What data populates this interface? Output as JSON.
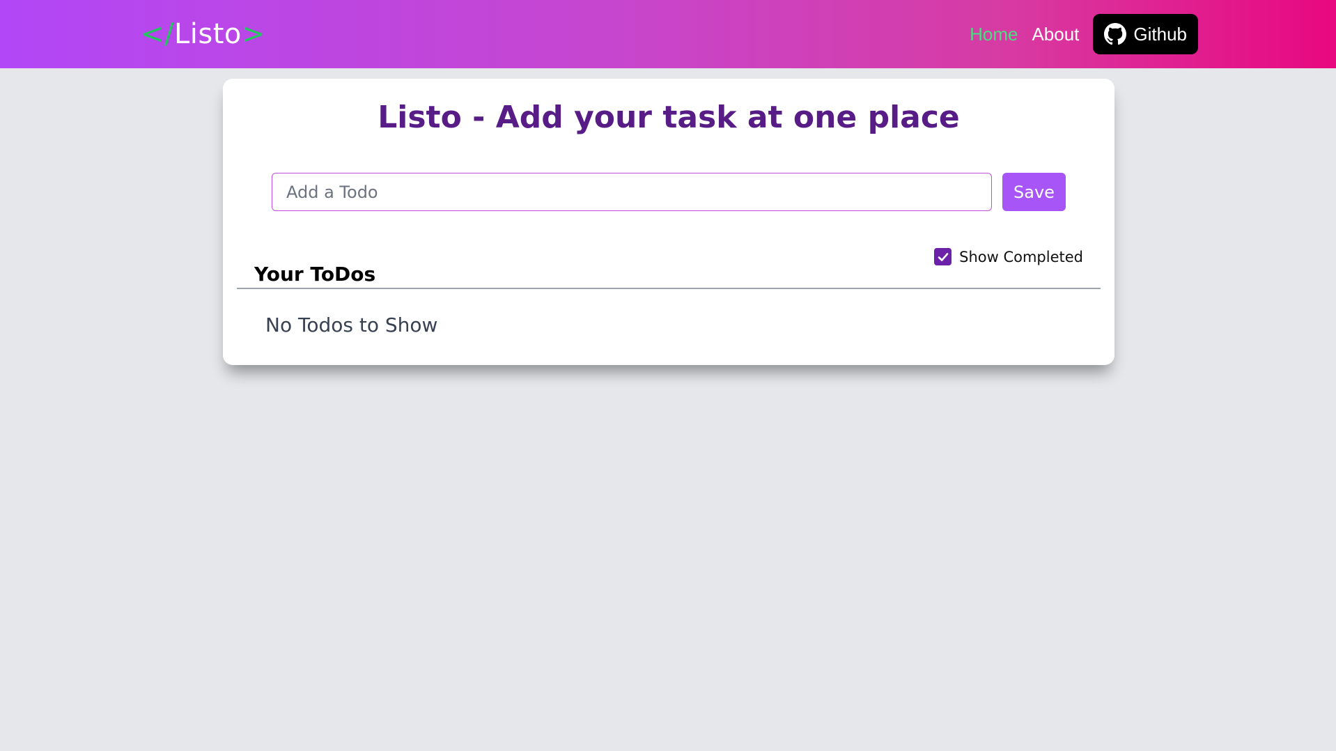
{
  "navbar": {
    "logo": {
      "open": "</",
      "text": "Listo",
      "close": ">"
    },
    "links": [
      {
        "label": "Home",
        "active": true
      },
      {
        "label": "About",
        "active": false
      }
    ],
    "github": {
      "label": "Github",
      "icon": "github-icon"
    }
  },
  "main": {
    "title": "Listo - Add your task at one place",
    "input": {
      "placeholder": "Add a Todo",
      "value": ""
    },
    "save_label": "Save",
    "todos_heading": "Your ToDos",
    "show_completed": {
      "label": "Show Completed",
      "checked": true
    },
    "empty_message": "No Todos to Show"
  },
  "colors": {
    "accent": "#a855f7",
    "title": "#581c87",
    "logo_bracket": "#22c55e",
    "active_link": "#4ade80",
    "checkbox": "#6b21a8"
  }
}
